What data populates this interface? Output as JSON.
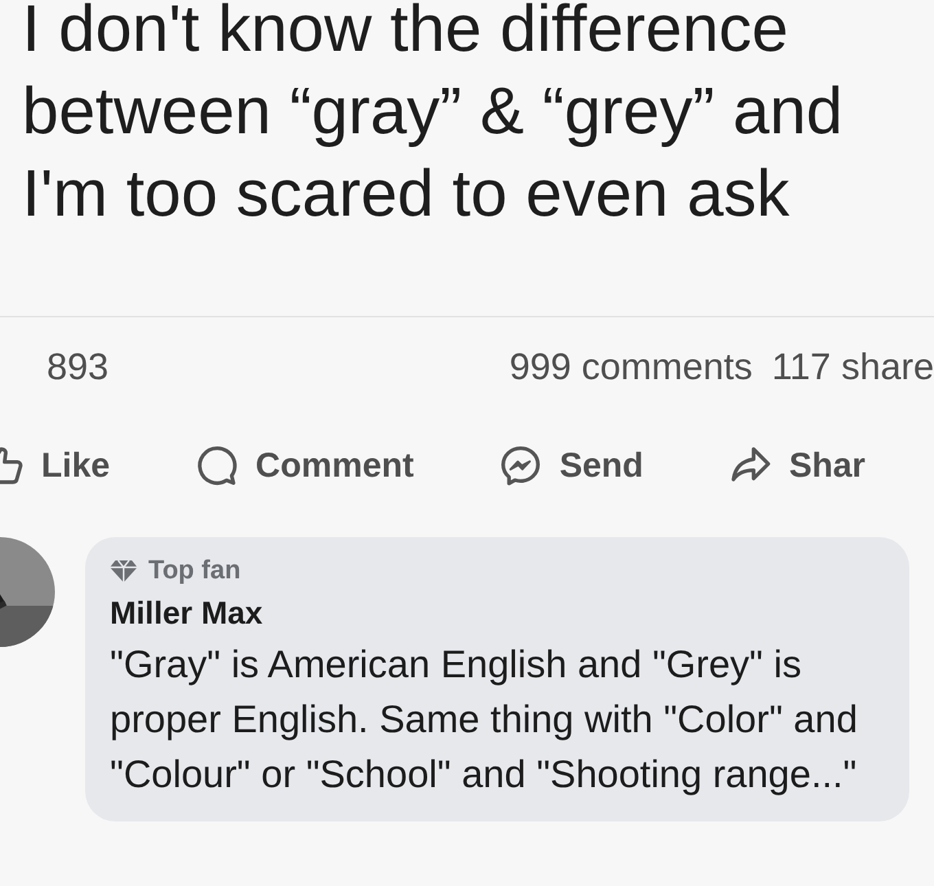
{
  "post": {
    "text_lines": [
      "I don't know the difference",
      "between “gray” & “grey” and",
      "I'm too scared to even ask"
    ],
    "reactions_count": "893",
    "comments_count": "999 comments",
    "shares_count": "117 share"
  },
  "actions": [
    {
      "kind": "like",
      "label": "Like"
    },
    {
      "kind": "comment",
      "label": "Comment"
    },
    {
      "kind": "send",
      "label": "Send"
    },
    {
      "kind": "share",
      "label": "Shar"
    }
  ],
  "comment": {
    "badge": "Top fan",
    "author": "Miller Max",
    "text": "\"Gray\" is American English and \"Grey\" is proper English. Same thing with \"Color\" and \"Colour\" or \"School\" and \"Shooting range...\""
  }
}
